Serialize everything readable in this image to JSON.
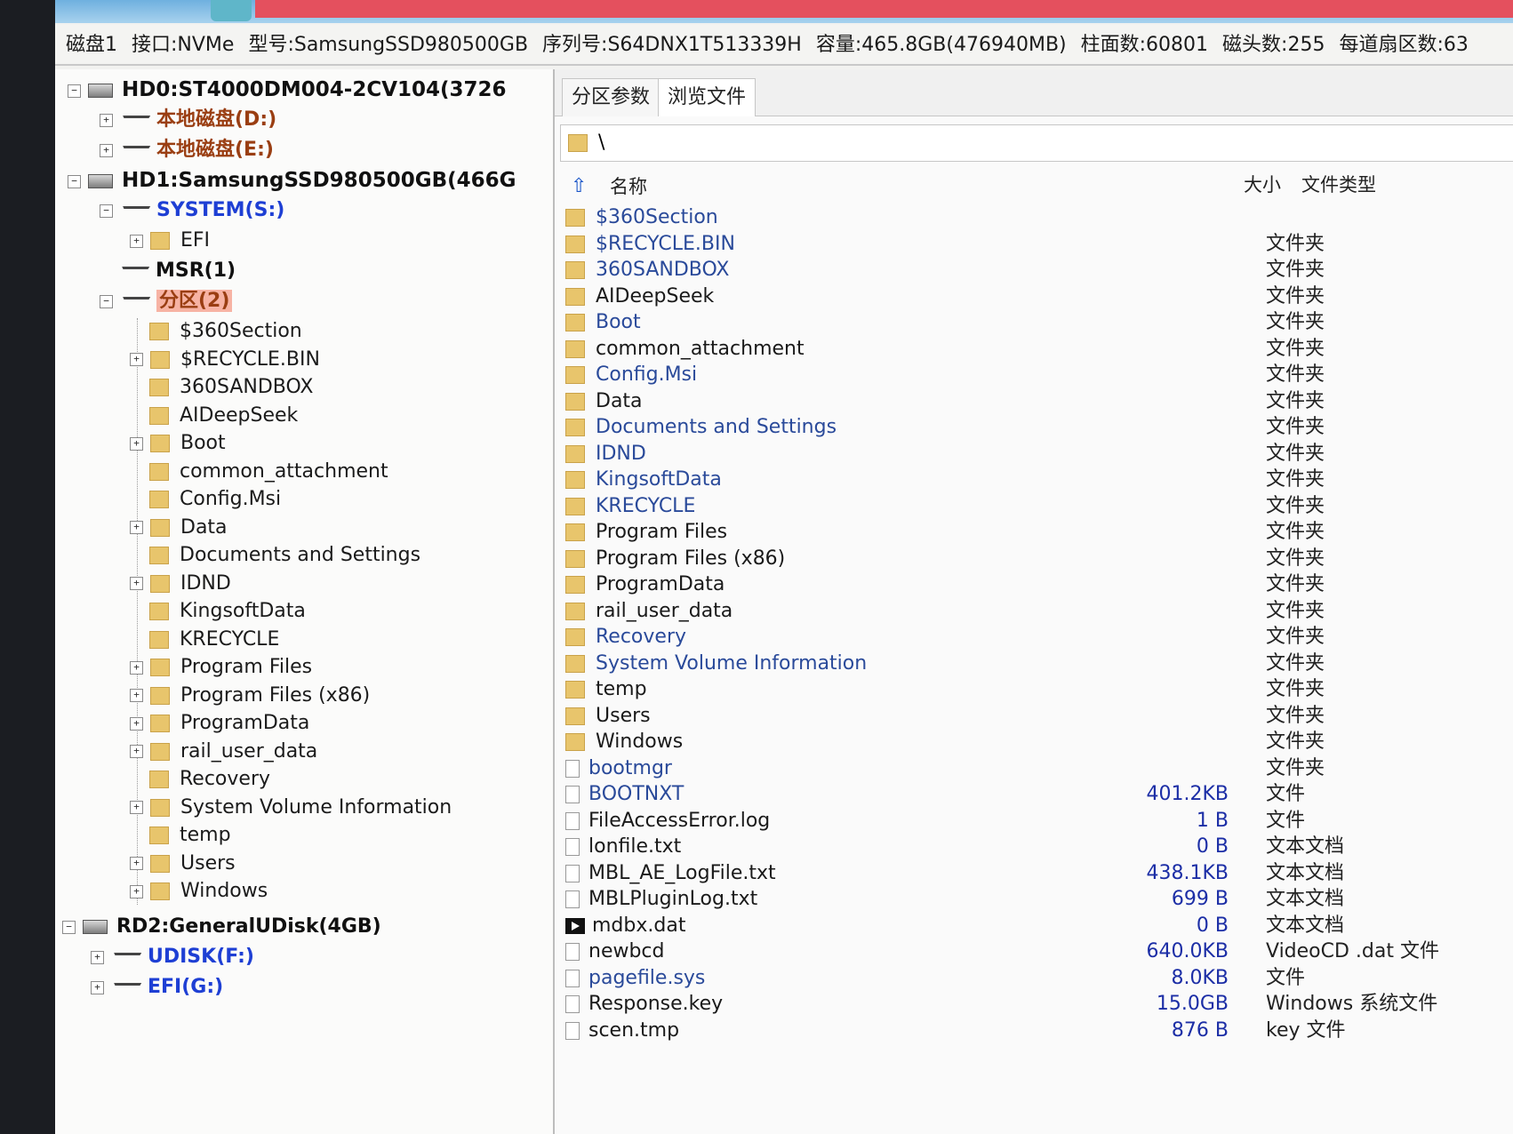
{
  "infobar": {
    "disk": "磁盘1",
    "interface": "接口:NVMe",
    "model": "型号:SamsungSSD980500GB",
    "serial": "序列号:S64DNX1T513339H",
    "capacity": "容量:465.8GB(476940MB)",
    "cylinders": "柱面数:60801",
    "heads": "磁头数:255",
    "sectors": "每道扇区数:63"
  },
  "tree": {
    "hd0": "HD0:ST4000DM004-2CV104(3726",
    "hd0_parts": [
      "本地磁盘(D:)",
      "本地磁盘(E:)"
    ],
    "hd1": "HD1:SamsungSSD980500GB(466G",
    "system": "SYSTEM(S:)",
    "efi": "EFI",
    "msr": "MSR(1)",
    "part2": "分区(2)",
    "folders": [
      "$360Section",
      "$RECYCLE.BIN",
      "360SANDBOX",
      "AIDeepSeek",
      "Boot",
      "common_attachment",
      "Config.Msi",
      "Data",
      "Documents and Settings",
      "IDND",
      "KingsoftData",
      "KRECYCLE",
      "Program Files",
      "Program Files (x86)",
      "ProgramData",
      "rail_user_data",
      "Recovery",
      "System Volume Information",
      "temp",
      "Users",
      "Windows"
    ],
    "rd2": "RD2:GeneralUDisk(4GB)",
    "udisk": "UDISK(F:)",
    "efig": "EFI(G:)"
  },
  "tabs": [
    "分区参数",
    "浏览文件"
  ],
  "path": "\\",
  "list": {
    "col_name": "名称",
    "col_size": "大小",
    "col_type": "文件类型",
    "rows": [
      {
        "name": "$360Section",
        "size": "",
        "type": ""
      },
      {
        "name": "$RECYCLE.BIN",
        "size": "",
        "type": "文件夹"
      },
      {
        "name": "360SANDBOX",
        "size": "",
        "type": "文件夹"
      },
      {
        "name": "AIDeepSeek",
        "size": "",
        "type": "文件夹"
      },
      {
        "name": "Boot",
        "size": "",
        "type": "文件夹"
      },
      {
        "name": "common_attachment",
        "size": "",
        "type": "文件夹"
      },
      {
        "name": "Config.Msi",
        "size": "",
        "type": "文件夹"
      },
      {
        "name": "Data",
        "size": "",
        "type": "文件夹"
      },
      {
        "name": "Documents and Settings",
        "size": "",
        "type": "文件夹"
      },
      {
        "name": "IDND",
        "size": "",
        "type": "文件夹"
      },
      {
        "name": "KingsoftData",
        "size": "",
        "type": "文件夹"
      },
      {
        "name": "KRECYCLE",
        "size": "",
        "type": "文件夹"
      },
      {
        "name": "Program Files",
        "size": "",
        "type": "文件夹"
      },
      {
        "name": "Program Files (x86)",
        "size": "",
        "type": "文件夹"
      },
      {
        "name": "ProgramData",
        "size": "",
        "type": "文件夹"
      },
      {
        "name": "rail_user_data",
        "size": "",
        "type": "文件夹"
      },
      {
        "name": "Recovery",
        "size": "",
        "type": "文件夹"
      },
      {
        "name": "System Volume Information",
        "size": "",
        "type": "文件夹"
      },
      {
        "name": "temp",
        "size": "",
        "type": "文件夹"
      },
      {
        "name": "Users",
        "size": "",
        "type": "文件夹"
      },
      {
        "name": "Windows",
        "size": "",
        "type": "文件夹"
      },
      {
        "name": "bootmgr",
        "size": "",
        "type": "文件夹"
      },
      {
        "name": "BOOTNXT",
        "size": "401.2KB",
        "type": "文件"
      },
      {
        "name": "FileAccessError.log",
        "size": "1 B",
        "type": "文件"
      },
      {
        "name": "lonfile.txt",
        "size": "0 B",
        "type": "文本文档"
      },
      {
        "name": "MBL_AE_LogFile.txt",
        "size": "438.1KB",
        "type": "文本文档"
      },
      {
        "name": "MBLPluginLog.txt",
        "size": "699 B",
        "type": "文本文档"
      },
      {
        "name": "mdbx.dat",
        "size": "0 B",
        "type": "文本文档"
      },
      {
        "name": "newbcd",
        "size": "640.0KB",
        "type": "VideoCD .dat 文件"
      },
      {
        "name": "pagefile.sys",
        "size": "8.0KB",
        "type": "文件"
      },
      {
        "name": "Response.key",
        "size": "15.0GB",
        "type": "Windows 系统文件"
      },
      {
        "name": "scen.tmp",
        "size": "876 B",
        "type": "key 文件"
      }
    ]
  }
}
